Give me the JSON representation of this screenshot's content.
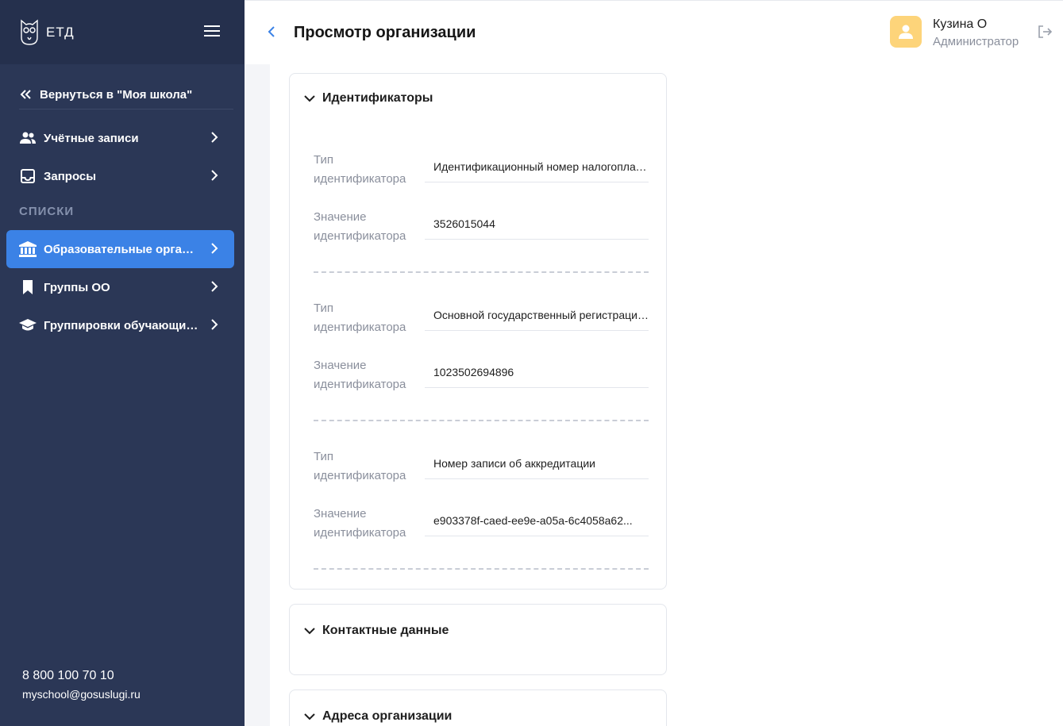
{
  "app": {
    "logo_text": "ЕТД"
  },
  "sidebar": {
    "back_label": "Вернуться в \"Моя школа\"",
    "items": [
      {
        "label": "Учётные записи",
        "icon": "users-icon"
      },
      {
        "label": "Запросы",
        "icon": "inbox-icon"
      }
    ],
    "section_title": "СПИСКИ",
    "list_items": [
      {
        "label": "Образовательные организации",
        "icon": "institution-icon",
        "active": true
      },
      {
        "label": "Группы ОО",
        "icon": "bookmark-icon",
        "active": false
      },
      {
        "label": "Группировки обучающихся",
        "icon": "graduation-cap-icon",
        "active": false
      }
    ],
    "footer": {
      "phone": "8 800 100 70 10",
      "email": "myschool@gosuslugi.ru"
    }
  },
  "header": {
    "title": "Просмотр организации",
    "user_name": "Кузина О",
    "user_role": "Администратор"
  },
  "sections": {
    "identifiers": {
      "title": "Идентификаторы",
      "type_label": "Тип идентификатора",
      "value_label": "Значение идентификатора",
      "items": [
        {
          "type": "Идентификационный номер налогоплательщика",
          "value": "3526015044"
        },
        {
          "type": "Основной государственный регистрационный номер",
          "value": "1023502694896"
        },
        {
          "type": "Номер записи об аккредитации",
          "value": "e903378f-caed-ee9e-a05a-6c4058a62..."
        }
      ]
    },
    "contacts": {
      "title": "Контактные данные"
    },
    "addresses": {
      "title": "Адреса организации"
    }
  },
  "colors": {
    "sidebar_bg": "#2b3756",
    "sidebar_header_bg": "#25304d",
    "accent": "#3b82e6",
    "avatar_bg": "#fdd47a"
  }
}
